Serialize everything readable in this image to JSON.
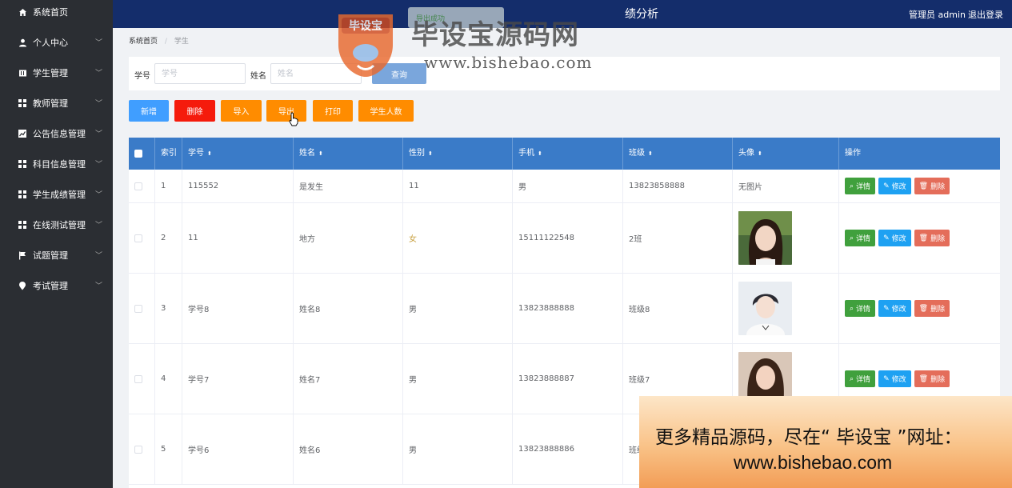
{
  "sidebar": {
    "items": [
      {
        "label": "系统首页",
        "icon": "home-icon"
      },
      {
        "label": "个人中心",
        "icon": "user-icon"
      },
      {
        "label": "学生管理",
        "icon": "book-icon"
      },
      {
        "label": "教师管理",
        "icon": "grid-icon"
      },
      {
        "label": "公告信息管理",
        "icon": "chart-icon"
      },
      {
        "label": "科目信息管理",
        "icon": "grid-icon"
      },
      {
        "label": "学生成绩管理",
        "icon": "grid-icon"
      },
      {
        "label": "在线测试管理",
        "icon": "grid-icon"
      },
      {
        "label": "试题管理",
        "icon": "flag-icon"
      },
      {
        "label": "考试管理",
        "icon": "location-icon"
      }
    ]
  },
  "header": {
    "title": "绩分析",
    "user": "管理员 admin",
    "logout": "退出登录",
    "toast": "导出成功"
  },
  "breadcrumb": {
    "home": "系统首页",
    "separator": "/",
    "current": "学生"
  },
  "search": {
    "id_label": "学号",
    "id_placeholder": "学号",
    "name_label": "姓名",
    "name_placeholder": "姓名",
    "button": "查询"
  },
  "actions": {
    "add": "新增",
    "delete": "删除",
    "import": "导入",
    "export": "导出",
    "print": "打印",
    "count": "学生人数"
  },
  "colors": {
    "header": "#142d6b",
    "sidebar": "#2b2e33",
    "table_head": "#3a7bc8",
    "add": "#409eff",
    "delete": "#f51b0c",
    "orange": "#ff8c00"
  },
  "table": {
    "headers": [
      "索引",
      "学号",
      "姓名",
      "性别",
      "手机",
      "班级",
      "头像",
      "操作"
    ],
    "rows": [
      {
        "index": "1",
        "id": "115552",
        "name": "是发生",
        "gender": "11",
        "phone": "男",
        "cls": "13823858888",
        "avatar": "无图片"
      },
      {
        "index": "2",
        "id": "11",
        "name": "地方",
        "gender": "女",
        "phone": "15111122548",
        "cls": "2班",
        "avatar": ""
      },
      {
        "index": "3",
        "id": "学号8",
        "name": "姓名8",
        "gender": "男",
        "phone": "13823888888",
        "cls": "班级8",
        "avatar": ""
      },
      {
        "index": "4",
        "id": "学号7",
        "name": "姓名7",
        "gender": "男",
        "phone": "13823888887",
        "cls": "班级7",
        "avatar": ""
      },
      {
        "index": "5",
        "id": "学号6",
        "name": "姓名6",
        "gender": "男",
        "phone": "13823888886",
        "cls": "班级6",
        "avatar": ""
      }
    ],
    "ops": {
      "detail": "详情",
      "edit": "修改",
      "delete": "删除"
    }
  },
  "watermark": {
    "title": "毕设宝源码网",
    "url": "www.bishebao.com",
    "logo_text": "毕设宝"
  },
  "promo": {
    "line1": "更多精品源码，尽在“ 毕设宝 ”网址：",
    "line2": "www.bishebao.com"
  }
}
